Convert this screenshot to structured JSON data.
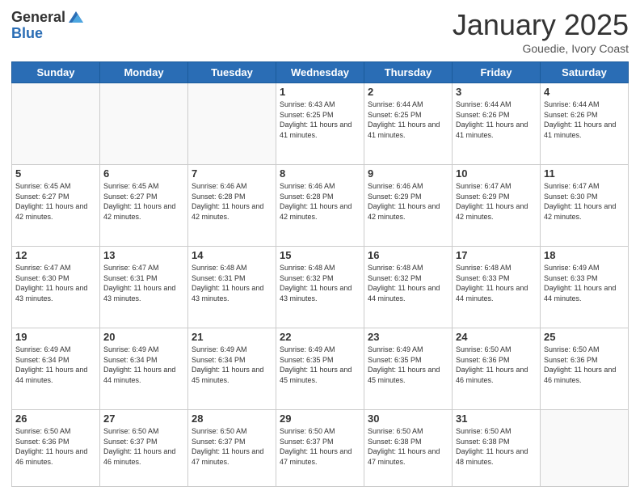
{
  "header": {
    "logo_general": "General",
    "logo_blue": "Blue",
    "title": "January 2025",
    "location": "Gouedie, Ivory Coast"
  },
  "days_of_week": [
    "Sunday",
    "Monday",
    "Tuesday",
    "Wednesday",
    "Thursday",
    "Friday",
    "Saturday"
  ],
  "weeks": [
    [
      {
        "day": "",
        "info": ""
      },
      {
        "day": "",
        "info": ""
      },
      {
        "day": "",
        "info": ""
      },
      {
        "day": "1",
        "info": "Sunrise: 6:43 AM\nSunset: 6:25 PM\nDaylight: 11 hours and 41 minutes."
      },
      {
        "day": "2",
        "info": "Sunrise: 6:44 AM\nSunset: 6:25 PM\nDaylight: 11 hours and 41 minutes."
      },
      {
        "day": "3",
        "info": "Sunrise: 6:44 AM\nSunset: 6:26 PM\nDaylight: 11 hours and 41 minutes."
      },
      {
        "day": "4",
        "info": "Sunrise: 6:44 AM\nSunset: 6:26 PM\nDaylight: 11 hours and 41 minutes."
      }
    ],
    [
      {
        "day": "5",
        "info": "Sunrise: 6:45 AM\nSunset: 6:27 PM\nDaylight: 11 hours and 42 minutes."
      },
      {
        "day": "6",
        "info": "Sunrise: 6:45 AM\nSunset: 6:27 PM\nDaylight: 11 hours and 42 minutes."
      },
      {
        "day": "7",
        "info": "Sunrise: 6:46 AM\nSunset: 6:28 PM\nDaylight: 11 hours and 42 minutes."
      },
      {
        "day": "8",
        "info": "Sunrise: 6:46 AM\nSunset: 6:28 PM\nDaylight: 11 hours and 42 minutes."
      },
      {
        "day": "9",
        "info": "Sunrise: 6:46 AM\nSunset: 6:29 PM\nDaylight: 11 hours and 42 minutes."
      },
      {
        "day": "10",
        "info": "Sunrise: 6:47 AM\nSunset: 6:29 PM\nDaylight: 11 hours and 42 minutes."
      },
      {
        "day": "11",
        "info": "Sunrise: 6:47 AM\nSunset: 6:30 PM\nDaylight: 11 hours and 42 minutes."
      }
    ],
    [
      {
        "day": "12",
        "info": "Sunrise: 6:47 AM\nSunset: 6:30 PM\nDaylight: 11 hours and 43 minutes."
      },
      {
        "day": "13",
        "info": "Sunrise: 6:47 AM\nSunset: 6:31 PM\nDaylight: 11 hours and 43 minutes."
      },
      {
        "day": "14",
        "info": "Sunrise: 6:48 AM\nSunset: 6:31 PM\nDaylight: 11 hours and 43 minutes."
      },
      {
        "day": "15",
        "info": "Sunrise: 6:48 AM\nSunset: 6:32 PM\nDaylight: 11 hours and 43 minutes."
      },
      {
        "day": "16",
        "info": "Sunrise: 6:48 AM\nSunset: 6:32 PM\nDaylight: 11 hours and 44 minutes."
      },
      {
        "day": "17",
        "info": "Sunrise: 6:48 AM\nSunset: 6:33 PM\nDaylight: 11 hours and 44 minutes."
      },
      {
        "day": "18",
        "info": "Sunrise: 6:49 AM\nSunset: 6:33 PM\nDaylight: 11 hours and 44 minutes."
      }
    ],
    [
      {
        "day": "19",
        "info": "Sunrise: 6:49 AM\nSunset: 6:34 PM\nDaylight: 11 hours and 44 minutes."
      },
      {
        "day": "20",
        "info": "Sunrise: 6:49 AM\nSunset: 6:34 PM\nDaylight: 11 hours and 44 minutes."
      },
      {
        "day": "21",
        "info": "Sunrise: 6:49 AM\nSunset: 6:34 PM\nDaylight: 11 hours and 45 minutes."
      },
      {
        "day": "22",
        "info": "Sunrise: 6:49 AM\nSunset: 6:35 PM\nDaylight: 11 hours and 45 minutes."
      },
      {
        "day": "23",
        "info": "Sunrise: 6:49 AM\nSunset: 6:35 PM\nDaylight: 11 hours and 45 minutes."
      },
      {
        "day": "24",
        "info": "Sunrise: 6:50 AM\nSunset: 6:36 PM\nDaylight: 11 hours and 46 minutes."
      },
      {
        "day": "25",
        "info": "Sunrise: 6:50 AM\nSunset: 6:36 PM\nDaylight: 11 hours and 46 minutes."
      }
    ],
    [
      {
        "day": "26",
        "info": "Sunrise: 6:50 AM\nSunset: 6:36 PM\nDaylight: 11 hours and 46 minutes."
      },
      {
        "day": "27",
        "info": "Sunrise: 6:50 AM\nSunset: 6:37 PM\nDaylight: 11 hours and 46 minutes."
      },
      {
        "day": "28",
        "info": "Sunrise: 6:50 AM\nSunset: 6:37 PM\nDaylight: 11 hours and 47 minutes."
      },
      {
        "day": "29",
        "info": "Sunrise: 6:50 AM\nSunset: 6:37 PM\nDaylight: 11 hours and 47 minutes."
      },
      {
        "day": "30",
        "info": "Sunrise: 6:50 AM\nSunset: 6:38 PM\nDaylight: 11 hours and 47 minutes."
      },
      {
        "day": "31",
        "info": "Sunrise: 6:50 AM\nSunset: 6:38 PM\nDaylight: 11 hours and 48 minutes."
      },
      {
        "day": "",
        "info": ""
      }
    ]
  ]
}
